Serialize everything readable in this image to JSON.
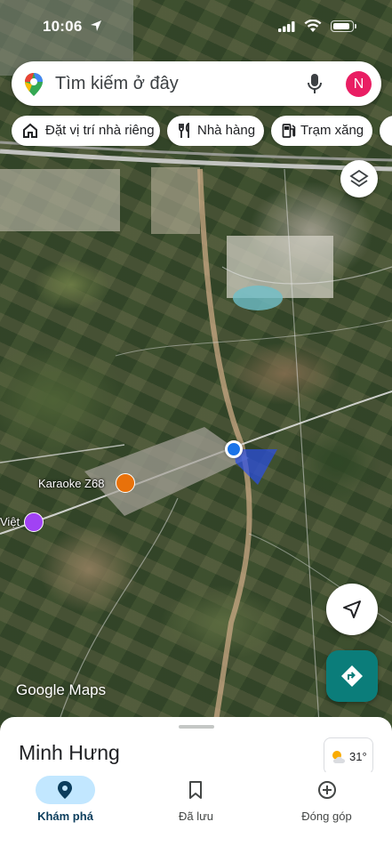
{
  "status_bar": {
    "time": "10:06"
  },
  "search": {
    "placeholder": "Tìm kiếm ở đây",
    "avatar_initial": "N"
  },
  "chips": [
    {
      "label": "Đặt vị trí nhà riêng",
      "icon": "home-icon"
    },
    {
      "label": "Nhà hàng",
      "icon": "restaurant-icon"
    },
    {
      "label": "Trạm xăng",
      "icon": "gas-station-icon"
    }
  ],
  "map": {
    "pois": [
      {
        "label": "Karaoke Z68",
        "icon": "cocktail-icon",
        "color": "#e8710a"
      },
      {
        "label": "Việt",
        "icon": "camera-icon",
        "color": "#a142f4"
      }
    ],
    "attribution": "Google Maps"
  },
  "sheet": {
    "place_name": "Minh Hưng",
    "temperature": "31°"
  },
  "bottom_nav": [
    {
      "label": "Khám phá",
      "icon": "explore-pin-icon",
      "active": true
    },
    {
      "label": "Đã lưu",
      "icon": "bookmark-icon",
      "active": false
    },
    {
      "label": "Đóng góp",
      "icon": "add-circle-icon",
      "active": false
    }
  ],
  "colors": {
    "accent": "#1a73e8",
    "directions": "#0b7d7a",
    "active_pill": "#c2e7ff"
  }
}
